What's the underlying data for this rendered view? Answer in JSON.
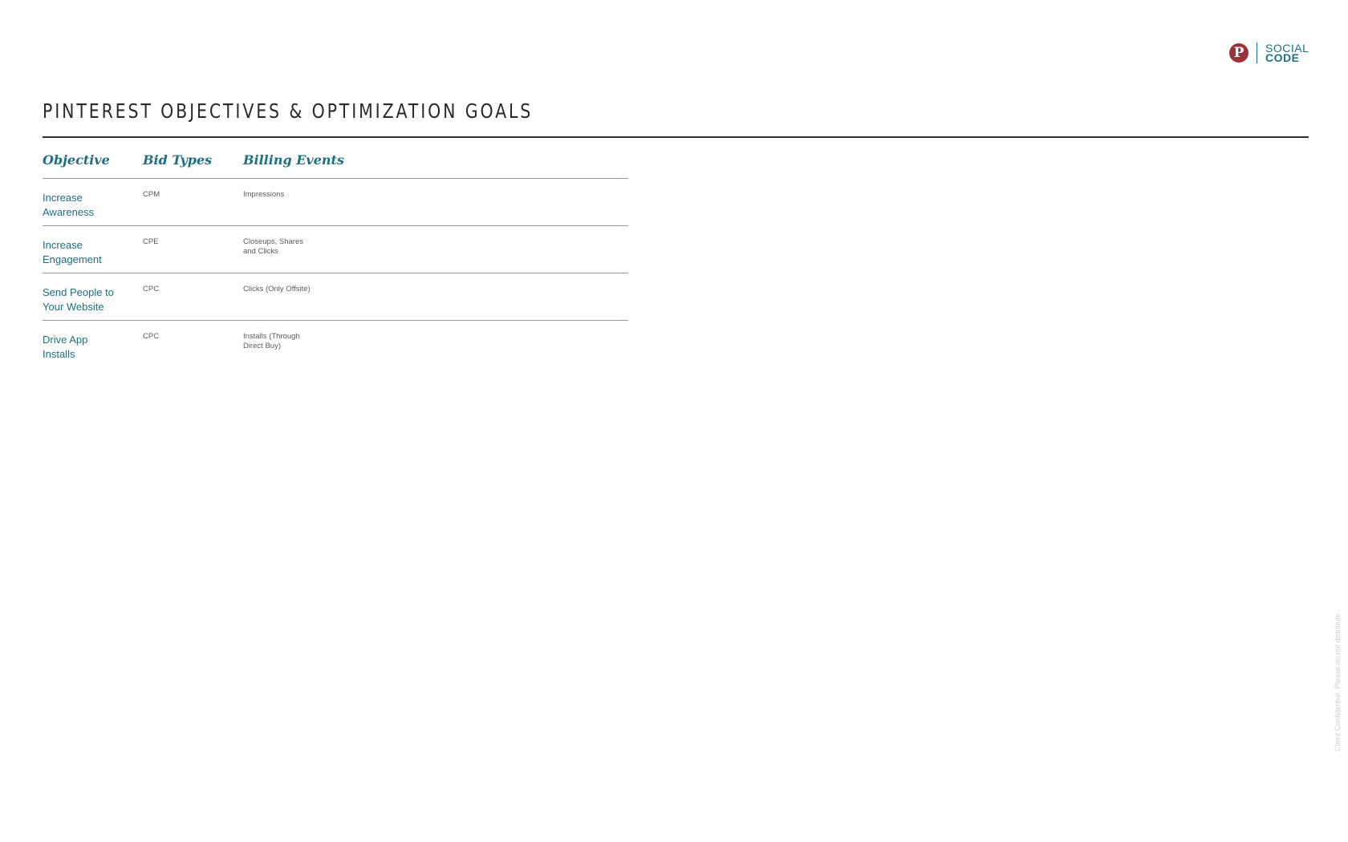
{
  "header": {
    "pinterest_icon_glyph": "P",
    "brand_line1": "SOCIAL",
    "brand_line2": "CODE",
    "brand_color": "#1e6f81",
    "pinterest_color": "#9b3339"
  },
  "page": {
    "title": "PINTEREST OBJECTIVES & OPTIMIZATION GOALS"
  },
  "table": {
    "headers": [
      "Objective",
      "Bid Types",
      "Billing Events"
    ],
    "rows": [
      {
        "objective": "Increase\nAwareness",
        "bid_type": "CPM",
        "billing_event": "Impressions"
      },
      {
        "objective": "Increase\nEngagement",
        "bid_type": "CPE",
        "billing_event": "Closeups, Shares\nand Clicks"
      },
      {
        "objective": "Send People to\nYour Website",
        "bid_type": "CPC",
        "billing_event": "Clicks (Only Offsite)"
      },
      {
        "objective": "Drive App\nInstalls",
        "bid_type": "CPC",
        "billing_event": "Installs (Through\nDirect Buy)"
      }
    ]
  },
  "footer": {
    "confidential_note": "Client Confidential. Please do not distribute"
  }
}
